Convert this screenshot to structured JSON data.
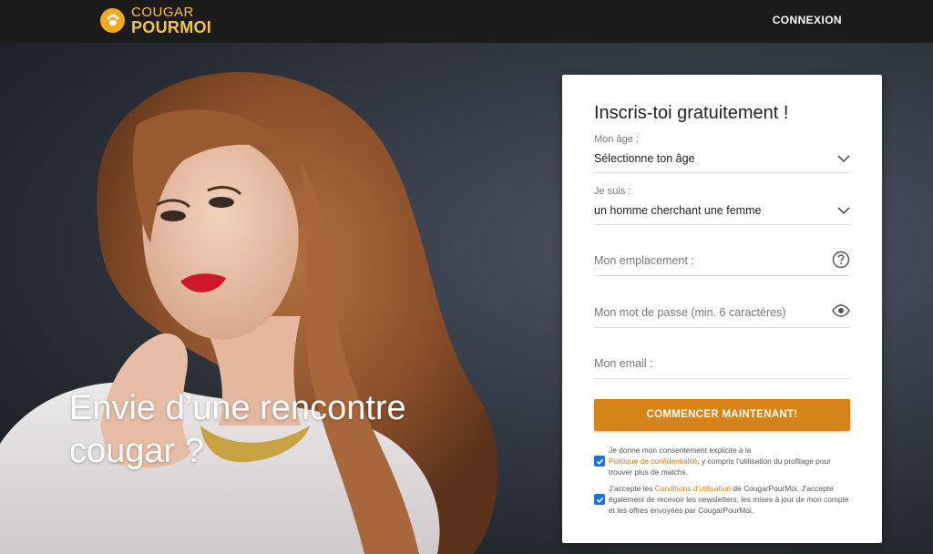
{
  "brand": {
    "line1": "COUGAR",
    "line2": "POURMOI",
    "accent": "#f3a81e"
  },
  "nav": {
    "login": "CONNEXION"
  },
  "hero": {
    "headline": "Envie d’une rencontre cougar ?"
  },
  "form": {
    "title": "Inscris-toi gratuitement !",
    "age": {
      "label": "Mon âge :",
      "value": "Sélectionne ton âge",
      "icon": "chevron-down-icon"
    },
    "iam": {
      "label": "Je suis :",
      "value": "un homme cherchant une femme",
      "icon": "chevron-down-icon"
    },
    "location": {
      "placeholder": "Mon emplacement :",
      "icon": "question-icon"
    },
    "password": {
      "placeholder": "Mon mot de passe (min. 6 caractères)",
      "icon": "eye-icon"
    },
    "email": {
      "placeholder": "Mon email :"
    },
    "submit": "COMMENCER MAINTENANT!",
    "consent1": {
      "checked": true,
      "pre": "Je donne mon consentement explicite à la",
      "link": "Politique de confidentialité",
      "post": ", y compris l’utilisation du profilage pour trouver plus de matchs."
    },
    "consent2": {
      "checked": true,
      "pre": "J’accepte les",
      "link": "Conditions d’utilisation",
      "post": "de CougarPourMoi. J’accepte également de recevoir les newsletters, les mises à jour de mon compte et les offres envoyées par CougarPourMoi."
    },
    "button_color": "#d6841a",
    "link_color": "#c97e12",
    "checkbox_color": "#1e73d6"
  }
}
